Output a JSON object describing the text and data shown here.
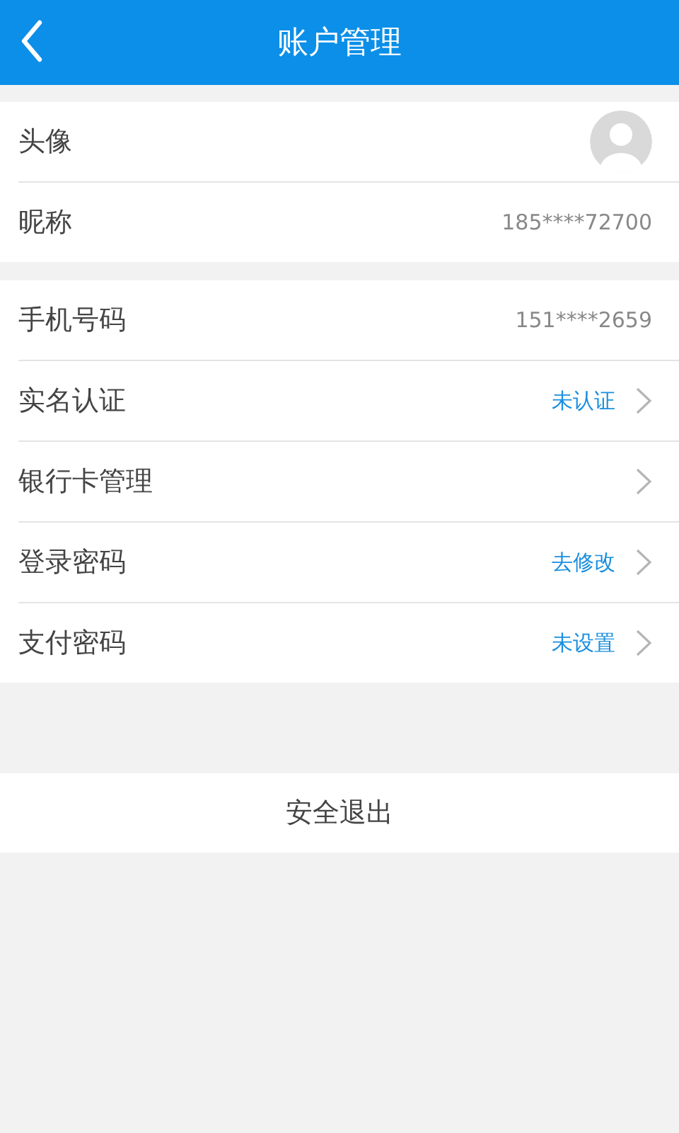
{
  "header": {
    "title": "账户管理"
  },
  "sections": [
    {
      "rows": [
        {
          "label": "头像",
          "kind": "avatar"
        },
        {
          "label": "昵称",
          "kind": "info",
          "value": "185****72700"
        }
      ]
    },
    {
      "rows": [
        {
          "label": "手机号码",
          "kind": "info",
          "value": "151****2659"
        },
        {
          "label": "实名认证",
          "kind": "action",
          "value": "未认证"
        },
        {
          "label": "银行卡管理",
          "kind": "nav"
        },
        {
          "label": "登录密码",
          "kind": "action",
          "value": "去修改"
        },
        {
          "label": "支付密码",
          "kind": "action",
          "value": "未设置"
        }
      ]
    }
  ],
  "logout": {
    "label": "安全退出"
  }
}
